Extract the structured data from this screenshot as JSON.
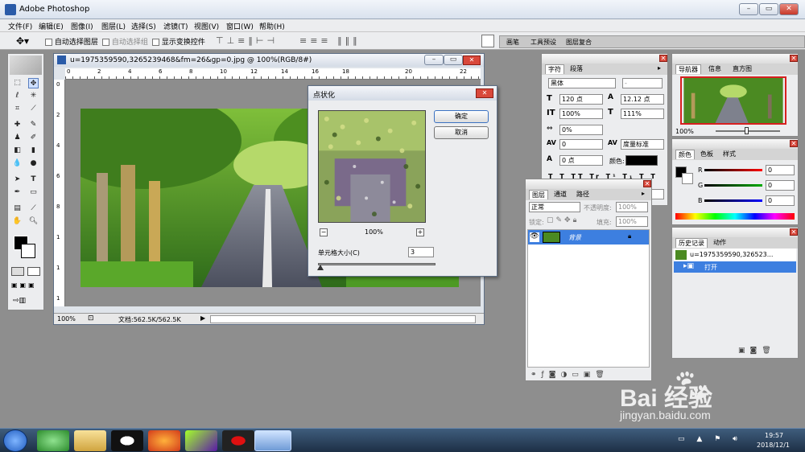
{
  "app": {
    "title": "Adobe Photoshop"
  },
  "menu": [
    "文件(F)",
    "编辑(E)",
    "图像(I)",
    "图层(L)",
    "选择(S)",
    "滤镜(T)",
    "视图(V)",
    "窗口(W)",
    "帮助(H)"
  ],
  "options": {
    "auto_select_layer": "自动选择图层",
    "auto_select_group": "自动选择组",
    "show_transform": "显示变换控件"
  },
  "docked_tabs": [
    "画笔",
    "工具预设",
    "图层复合"
  ],
  "document": {
    "title": "u=1975359590,3265239468&fm=26&gp=0.jpg @ 100%(RGB/8#)",
    "zoom": "100%",
    "doc_info": "文档:562.5K/562.5K",
    "ruler_top": [
      "0",
      "2",
      "4",
      "6",
      "8",
      "10",
      "12",
      "14",
      "16",
      "18",
      "20",
      "22"
    ],
    "ruler_left": [
      "0",
      "2",
      "4",
      "6",
      "8",
      "1",
      "1",
      "1"
    ]
  },
  "dialog": {
    "title": "点状化",
    "ok": "确定",
    "cancel": "取消",
    "zoom": "100%",
    "minus": "−",
    "plus": "+",
    "cell_size_label": "单元格大小(C)",
    "cell_size_value": "3"
  },
  "character": {
    "tabs": [
      "字符",
      "段落"
    ],
    "font_family": "黑体",
    "font_style": "-",
    "size": "120 点",
    "leading": "12.12 点",
    "vscale": "100%",
    "hscale": "111%",
    "tracking_kern": "0%",
    "tracking": "0",
    "kerning": "度量标准",
    "baseline": "0 点",
    "color_label": "颜色:"
  },
  "navigator": {
    "tabs": [
      "导航器",
      "信息",
      "直方图"
    ],
    "zoom": "100%"
  },
  "color": {
    "tabs": [
      "颜色",
      "色板",
      "样式"
    ],
    "r": "0",
    "g": "0",
    "b": "0",
    "r_label": "R",
    "g_label": "G",
    "b_label": "B"
  },
  "layers": {
    "tabs": [
      "图层",
      "通道",
      "路径"
    ],
    "blend_mode": "正常",
    "opacity_label": "不透明度:",
    "opacity": "100%",
    "lock_label": "锁定:",
    "fill_label": "填充:",
    "fill": "100%",
    "layer_name": "背景"
  },
  "history": {
    "tabs": [
      "历史记录",
      "动作"
    ],
    "snapshot": "u=1975359590,326523...",
    "step": "打开"
  },
  "taskbar": {
    "time": "19:57",
    "date": "2018/12/1"
  },
  "watermark": {
    "brand": "Bai 经验",
    "url": "jingyan.baidu.com"
  }
}
